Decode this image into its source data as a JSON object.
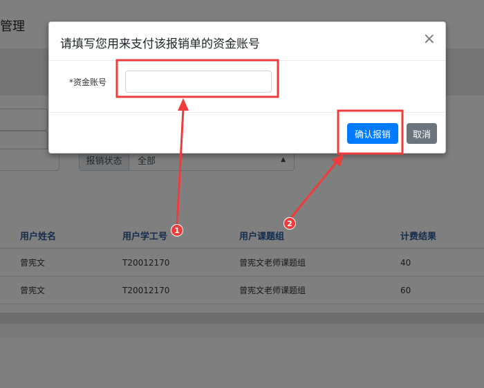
{
  "page": {
    "title": "管理",
    "filter": {
      "label": "报销状态",
      "selected": "全部"
    },
    "table": {
      "headers": [
        "用户姓名",
        "用户学工号",
        "用户课题组",
        "计费结果"
      ],
      "rows": [
        [
          "曾宪文",
          "T20012170",
          "曾宪文老师课题组",
          "40"
        ],
        [
          "曾宪文",
          "T20012170",
          "曾宪文老师课题组",
          "60"
        ]
      ]
    }
  },
  "modal": {
    "title": "请填写您用来支付该报销单的资金账号",
    "close_icon": "×",
    "field_label": "*资金账号",
    "field_value": "",
    "confirm_label": "确认报销",
    "cancel_label": "取消"
  },
  "annotations": {
    "badge1": "1",
    "badge2": "2",
    "color": "#ee3b3b"
  },
  "icons": {
    "select_caret": "caret-updown-icon",
    "close": "close-icon"
  }
}
